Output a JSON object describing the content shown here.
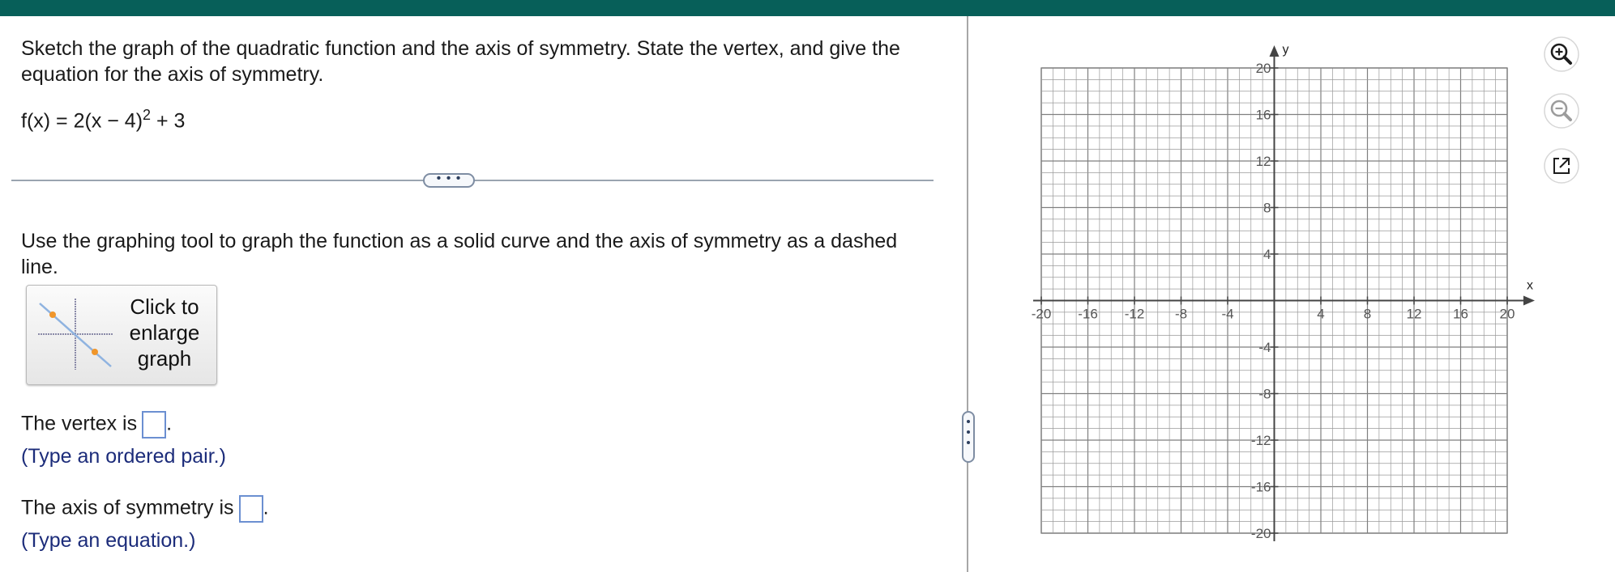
{
  "question": {
    "prompt": "Sketch the graph of the quadratic function and the axis of symmetry. State the vertex, and give the equation for the axis of symmetry.",
    "function_main": "f(x) = 2(x − 4)",
    "function_exp": "2",
    "function_tail": " + 3",
    "more_label": "• • •"
  },
  "instruction": "Use the graphing tool to graph the function as a solid curve and the axis of symmetry as a dashed line.",
  "enlarge_button": {
    "line1": "Click to",
    "line2": "enlarge",
    "line3": "graph"
  },
  "answers": {
    "vertex_prefix": "The vertex is",
    "vertex_value": "",
    "vertex_hint": "(Type an ordered pair.)",
    "axis_prefix": "The axis of symmetry is",
    "axis_value": "",
    "axis_hint": "(Type an equation.)",
    "suffix": "."
  },
  "graph": {
    "x_label": "x",
    "y_label": "y",
    "x_ticks": [
      "-20",
      "-16",
      "-12",
      "-8",
      "-4",
      "4",
      "8",
      "12",
      "16",
      "20"
    ],
    "y_ticks": [
      "20",
      "16",
      "12",
      "8",
      "4",
      "-4",
      "-8",
      "-12",
      "-16",
      "-20"
    ],
    "range": [
      -20,
      20
    ],
    "grid_step": 1,
    "tick_step": 4,
    "grid": true
  },
  "tools": [
    {
      "name": "zoom-in",
      "icon": "zoom-in-icon"
    },
    {
      "name": "zoom-out",
      "icon": "zoom-out-icon"
    },
    {
      "name": "open-new-window",
      "icon": "external-link-icon"
    }
  ],
  "colors": {
    "topbar": "#075f59",
    "hint_text": "#1c2c7a",
    "answer_box_border": "#6b8fd1",
    "grid": "#9a9a9a",
    "axis": "#444444"
  }
}
